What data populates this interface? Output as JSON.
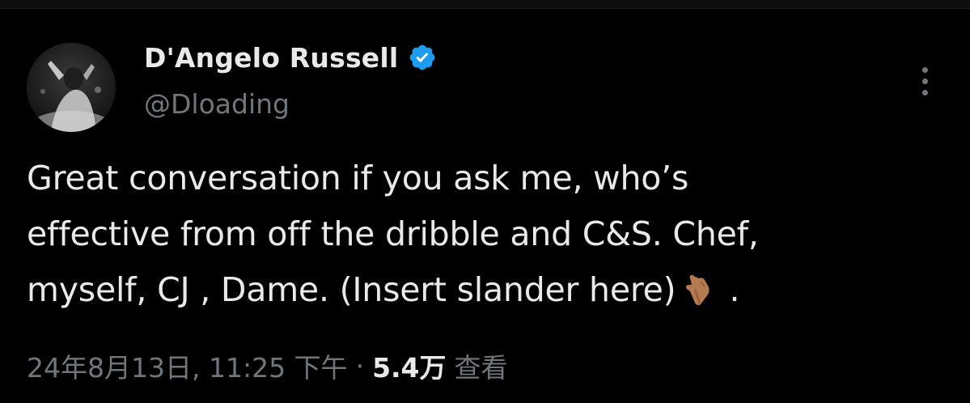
{
  "author": {
    "display_name": "D'Angelo Russell",
    "handle": "@Dloading",
    "verified": true,
    "verified_color": "#1d9bf0"
  },
  "tweet": {
    "text_lines": [
      "Great conversation if you ask me, who’s",
      "effective from off the dribble and C&S. Chef,",
      "myself, CJ , Dame. (Insert slander here)",
      "."
    ],
    "emoji": "backhand-index-pointing-down"
  },
  "meta": {
    "timestamp": "24年8月13日, 11:25 下午",
    "separator": "·",
    "views_count": "5.4万",
    "views_label": "查看"
  },
  "icons": {
    "more": "more-vertical-icon",
    "verified": "verified-badge-icon",
    "emoji": "pointing-down-emoji"
  },
  "colors": {
    "background": "#000000",
    "primary_text": "#e7e9ea",
    "secondary_text": "#71767b",
    "accent": "#1d9bf0"
  }
}
